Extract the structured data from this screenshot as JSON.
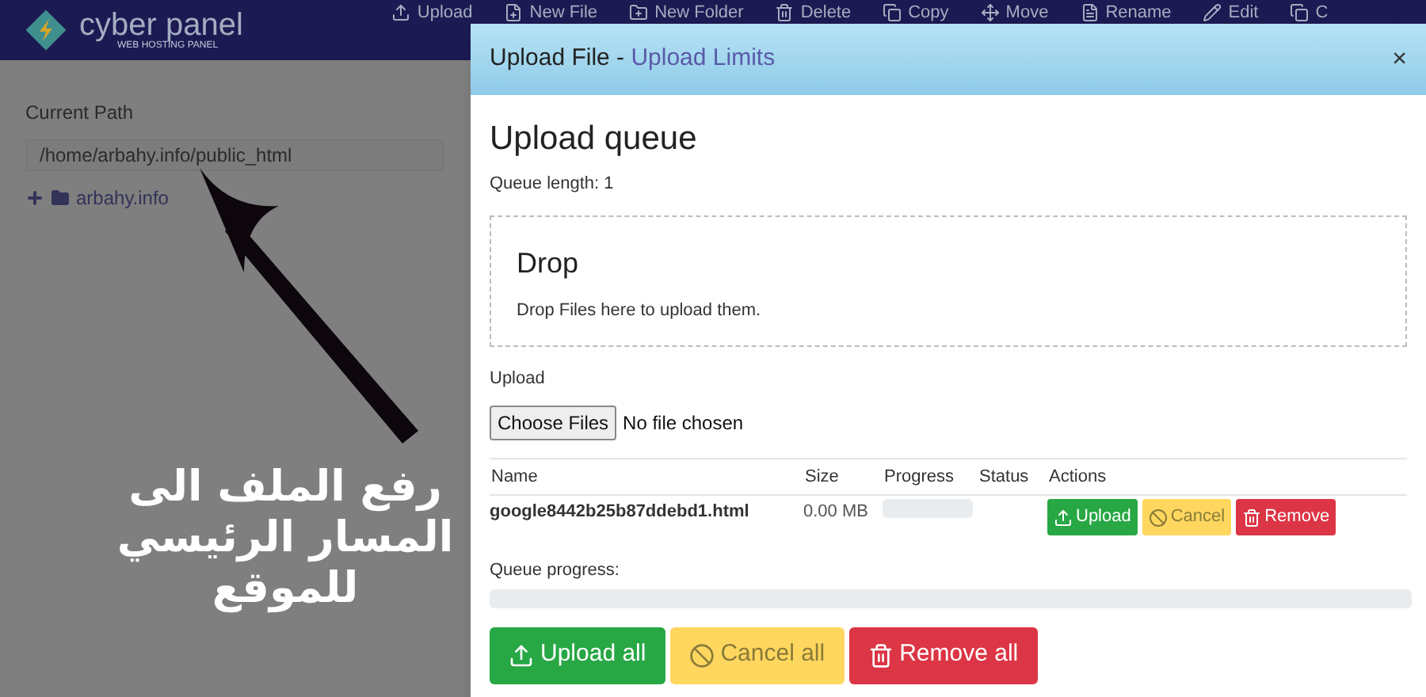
{
  "brand": {
    "name": "cyber panel",
    "tagline": "WEB HOSTING PANEL"
  },
  "toolbar": [
    "Upload",
    "New File",
    "New Folder",
    "Delete",
    "Copy",
    "Move",
    "Rename",
    "Edit",
    "C"
  ],
  "sidebar": {
    "path_label": "Current Path",
    "path_value": "/home/arbahy.info/public_html",
    "tree": [
      {
        "label": "arbahy.info",
        "expanded": false
      }
    ]
  },
  "annotation": {
    "text": "رفع الملف الى المسار الرئيسي للموقع"
  },
  "modal": {
    "title": "Upload File - ",
    "title_link": "Upload Limits",
    "close": "×",
    "heading": "Upload queue",
    "queue_length": "Queue length: 1",
    "drop": {
      "title": "Drop",
      "text": "Drop Files here to upload them."
    },
    "upload_label": "Upload",
    "choose_button": "Choose Files",
    "no_file": "No file chosen",
    "columns": [
      "Name",
      "Size",
      "Progress",
      "Status",
      "Actions"
    ],
    "rows": [
      {
        "name": "google8442b25b87ddebd1.html",
        "size": "0.00 MB",
        "level": 0,
        "actions": [
          {
            "kind": "upload",
            "label": "Upload"
          },
          {
            "kind": "cancel",
            "label": "Cancel"
          },
          {
            "kind": "remove",
            "label": "Remove"
          }
        ]
      }
    ],
    "queue_progress": {
      "label": "Queue progress:",
      "level": 0
    },
    "buttons": [
      {
        "kind": "upload",
        "label": "Upload all"
      },
      {
        "kind": "cancel",
        "label": "Cancel all"
      },
      {
        "kind": "remove",
        "label": "Remove all"
      }
    ]
  }
}
